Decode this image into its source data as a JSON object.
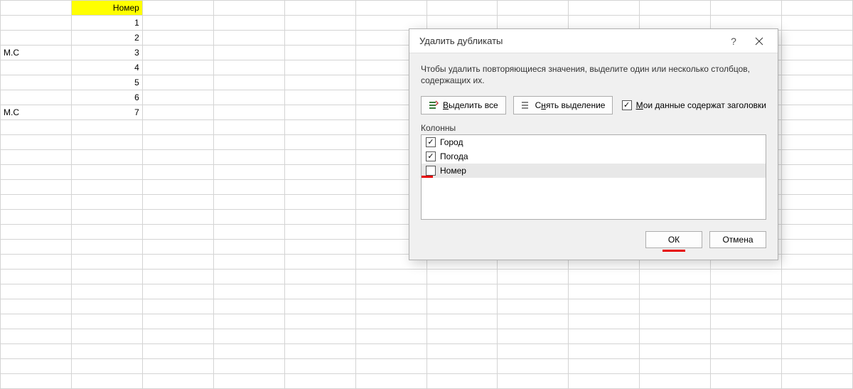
{
  "sheet": {
    "header_cell": "Номер",
    "rows": [
      {
        "a": "",
        "b": "1"
      },
      {
        "a": "",
        "b": "2"
      },
      {
        "a": "М.С",
        "b": "3"
      },
      {
        "a": "",
        "b": "4"
      },
      {
        "a": "",
        "b": "5"
      },
      {
        "a": "",
        "b": "6"
      },
      {
        "a": "М.С",
        "b": "7"
      }
    ]
  },
  "dialog": {
    "title": "Удалить дубликаты",
    "help_tooltip": "?",
    "description": "Чтобы удалить повторяющиеся значения, выделите один или несколько столбцов, содержащих их.",
    "select_all": "Выделить все",
    "deselect_all": "Снять выделение",
    "headers_label": "Мои данные содержат заголовки",
    "headers_checked": true,
    "columns_label": "Колонны",
    "columns": [
      {
        "label": "Город",
        "checked": true,
        "selected": false
      },
      {
        "label": "Погода",
        "checked": true,
        "selected": false
      },
      {
        "label": "Номер",
        "checked": false,
        "selected": true
      }
    ],
    "ok": "ОК",
    "cancel": "Отмена"
  }
}
